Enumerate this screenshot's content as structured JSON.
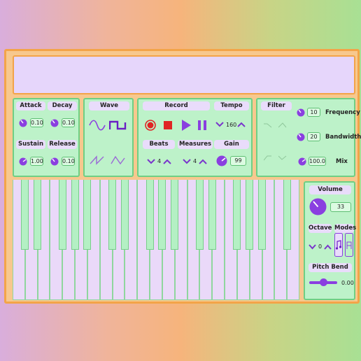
{
  "envelope": {
    "attack_label": "Attack",
    "attack_value": "0.10",
    "decay_label": "Decay",
    "decay_value": "0.10",
    "sustain_label": "Sustain",
    "sustain_value": "1.00",
    "release_label": "Release",
    "release_value": "0.10"
  },
  "wave": {
    "label": "Wave",
    "types": [
      "sine-wave-icon",
      "square-wave-icon",
      "sawtooth-wave-icon",
      "triangle-wave-icon"
    ],
    "selected": "square"
  },
  "record": {
    "label": "Record",
    "beats_label": "Beats",
    "beats_value": "4",
    "measures_label": "Measures",
    "measures_value": "4"
  },
  "tempo": {
    "label": "Tempo",
    "value": "160"
  },
  "gain": {
    "label": "Gain",
    "value": "99"
  },
  "filter": {
    "label": "Filter",
    "frequency_label": "Frequency",
    "frequency_value": "10",
    "bandwidth_label": "Bandwidth",
    "bandwidth_value": "20",
    "mix_label": "Mix",
    "mix_value": "100.0"
  },
  "volume": {
    "label": "Volume",
    "value": "33"
  },
  "octave": {
    "label": "Octave",
    "value": "0"
  },
  "modes": {
    "label": "Modes",
    "items": [
      "music-note-icon",
      "letter-a-icon"
    ]
  },
  "pitch_bend": {
    "label": "Pitch Bend",
    "value": "0.00",
    "level": 0.5
  },
  "colors": {
    "accent": "#8a3fe0",
    "panel": "#bdf2c9",
    "panel_border": "#6fcf84",
    "frame": "#f3a448",
    "label_bg": "#e9dcfb",
    "record_red": "#e02424"
  },
  "keyboard": {
    "white_keys": 23,
    "black_key_pattern": [
      1,
      1,
      0,
      1,
      1,
      1,
      0
    ]
  }
}
